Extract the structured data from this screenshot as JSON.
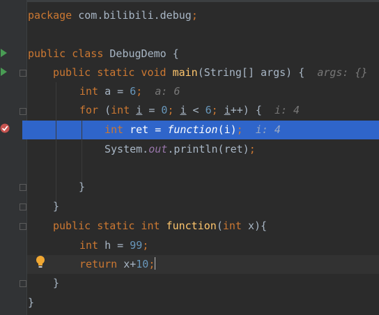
{
  "code": {
    "l1": {
      "pkg": "package",
      "name": " com.bilibili.debug",
      "semi": ";"
    },
    "l3": {
      "mod": "public class",
      "name": " DebugDemo {"
    },
    "l4": {
      "mod": "public static void",
      "fn": " main",
      "args": "(String[] args) {",
      "hint": "args: {}"
    },
    "l5": {
      "type": "int",
      "decl": " a = ",
      "num": "6",
      "semi": ";",
      "hint": "a: 6"
    },
    "l6": {
      "kw": "for",
      "p1": " (",
      "type": "int",
      "sp": " ",
      "i1": "i",
      "eq": " = ",
      "n0": "0",
      "semi1": ";",
      "sp2": " ",
      "i2": "i",
      "lt": " < ",
      "n6": "6",
      "semi2": ";",
      "sp3": " ",
      "i3": "i",
      "inc": "++) {",
      "hint": "i: 4"
    },
    "l7": {
      "type": "int",
      "decl": " ret = ",
      "fn": "function",
      "arg": "(i)",
      "semi": ";",
      "hint": "i: 4"
    },
    "l8": {
      "sys": "System.",
      "fld": "out",
      "call": ".println(ret)",
      "semi": ";"
    },
    "l10": {
      "text": "}"
    },
    "l11": {
      "text": "}"
    },
    "l12": {
      "mod": "public static int",
      "fn": " function",
      "p1": "(",
      "type": "int",
      "rest": " x){"
    },
    "l13": {
      "type": "int",
      "decl": " h = ",
      "num": "99",
      "semi": ";"
    },
    "l14": {
      "kw": "return",
      "rest": " x+",
      "num": "10",
      "semi": ";"
    },
    "l15": {
      "text": "}"
    },
    "l16": {
      "text": "}"
    }
  },
  "gutter": {
    "run_icons": [
      "run-class-icon",
      "run-main-icon"
    ],
    "breakpoint": "breakpoint-icon",
    "intention": "lightbulb-icon"
  },
  "colors": {
    "background": "#2b2b2b",
    "keyword": "#cc7832",
    "number": "#6897bb",
    "method": "#ffc66d",
    "field": "#9876aa",
    "execution_line": "#2f65ca",
    "breakpoint": "#c75450",
    "run": "#499c54"
  }
}
